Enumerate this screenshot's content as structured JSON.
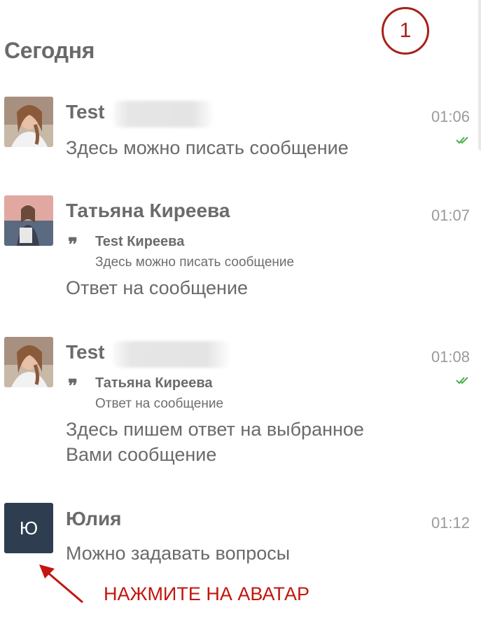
{
  "step_badge": "1",
  "section_title": "Сегодня",
  "messages": [
    {
      "author": "Test",
      "time": "01:06",
      "text": "Здесь можно писать сообщение",
      "read": true
    },
    {
      "author": "Татьяна Киреева",
      "time": "01:07",
      "quote": {
        "author": "Test Киреева",
        "text": "Здесь можно писать сообщение"
      },
      "text": "Ответ на сообщение"
    },
    {
      "author": "Test",
      "time": "01:08",
      "quote": {
        "author": "Татьяна Киреева",
        "text": "Ответ на сообщение"
      },
      "text_lines": [
        "Здесь пишем ответ на выбранное",
        "Вами сообщение"
      ],
      "read": true
    },
    {
      "author": "Юлия",
      "avatar_letter": "Ю",
      "time": "01:12",
      "text": "Можно задавать вопросы"
    }
  ],
  "hint": "НАЖМИТЕ НА АВАТАР",
  "colors": {
    "annotation_red": "#c2160e",
    "avatar_dark": "#2e3e50",
    "read_check": "#4caf50"
  }
}
